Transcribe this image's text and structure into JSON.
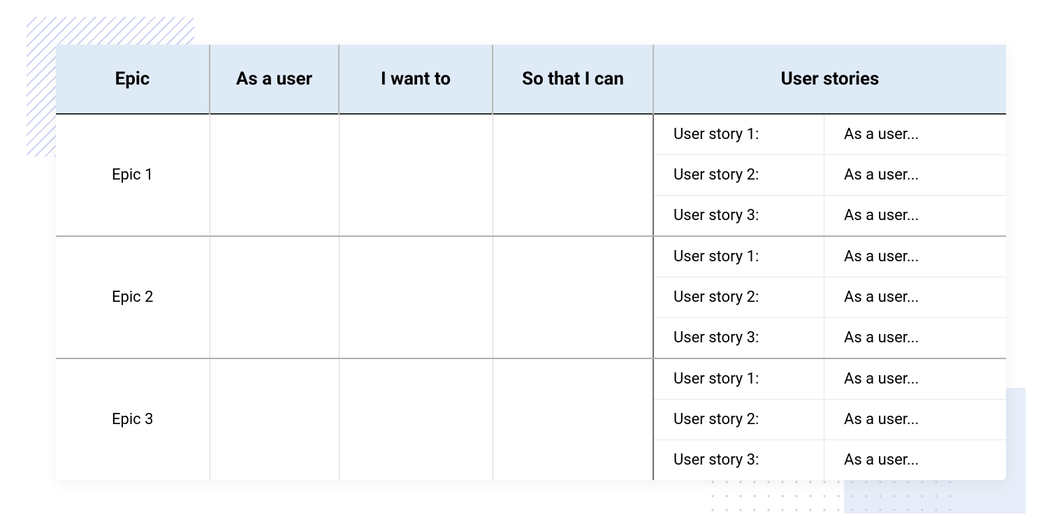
{
  "headers": {
    "epic": "Epic",
    "as_a_user": "As a user",
    "i_want_to": "I want to",
    "so_that": "So that I can",
    "user_stories": "User stories"
  },
  "rows": [
    {
      "epic": "Epic 1",
      "as_a_user": "",
      "i_want_to": "",
      "so_that": "",
      "stories": [
        {
          "label": "User story 1:",
          "text": "As a user..."
        },
        {
          "label": "User story 2:",
          "text": "As a user..."
        },
        {
          "label": "User story 3:",
          "text": "As a user..."
        }
      ]
    },
    {
      "epic": "Epic 2",
      "as_a_user": "",
      "i_want_to": "",
      "so_that": "",
      "stories": [
        {
          "label": "User story 1:",
          "text": "As a user..."
        },
        {
          "label": "User story 2:",
          "text": "As a user..."
        },
        {
          "label": "User story 3:",
          "text": "As a user..."
        }
      ]
    },
    {
      "epic": "Epic 3",
      "as_a_user": "",
      "i_want_to": "",
      "so_that": "",
      "stories": [
        {
          "label": "User story 1:",
          "text": "As a user..."
        },
        {
          "label": "User story 2:",
          "text": "As a user..."
        },
        {
          "label": "User story 3:",
          "text": "As a user..."
        }
      ]
    }
  ]
}
